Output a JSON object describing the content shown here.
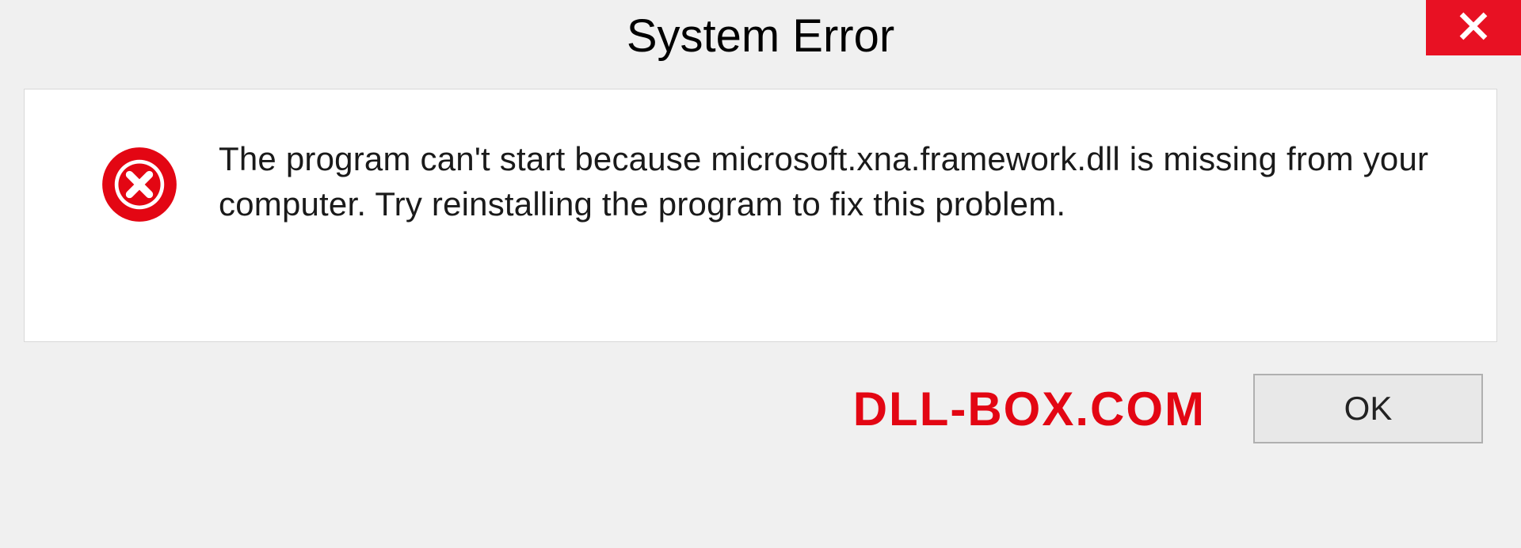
{
  "dialog": {
    "title": "System Error",
    "message": "The program can't start because microsoft.xna.framework.dll is missing from your computer. Try reinstalling the program to fix this problem.",
    "ok_label": "OK"
  },
  "watermark": "DLL-BOX.COM",
  "colors": {
    "close_bg": "#e81123",
    "error_icon": "#e30613",
    "watermark": "#e30613"
  }
}
